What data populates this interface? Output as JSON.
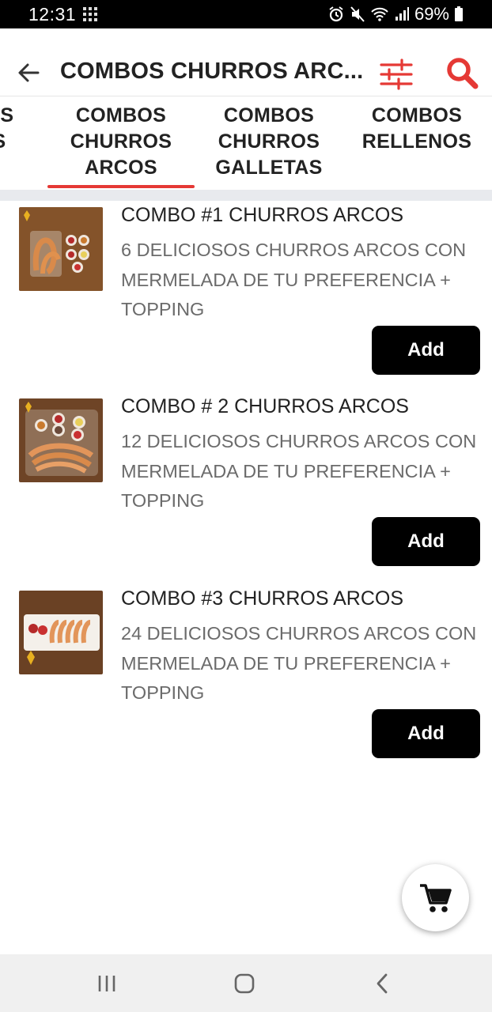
{
  "status_bar": {
    "time": "12:31",
    "battery": "69%"
  },
  "header": {
    "title": "COMBOS CHURROS ARC...",
    "back_icon": "arrow-left-icon",
    "filter_icon": "sliders-icon",
    "search_icon": "search-icon",
    "accent_color": "#e53935"
  },
  "tabs": [
    {
      "label": "OS\nS"
    },
    {
      "label": "COMBOS\nCHURROS\nARCOS",
      "active": true
    },
    {
      "label": "COMBOS\nCHURROS\nGALLETAS"
    },
    {
      "label": "COMBOS\nRELLENOS"
    }
  ],
  "products": [
    {
      "title": "COMBO #1 CHURROS ARCOS",
      "description": "6 DELICIOSOS CHURROS ARCOS CON MERMELADA DE TU PREFERENCIA + TOPPING",
      "add_label": "Add"
    },
    {
      "title": "COMBO # 2 CHURROS ARCOS",
      "description": "12 DELICIOSOS CHURROS ARCOS CON MERMELADA DE TU PREFERENCIA + TOPPING",
      "add_label": "Add"
    },
    {
      "title": "COMBO #3 CHURROS ARCOS",
      "description": "24 DELICIOSOS CHURROS ARCOS CON MERMELADA DE TU PREFERENCIA + TOPPING",
      "add_label": "Add"
    }
  ],
  "cart": {
    "icon": "shopping-cart-icon"
  },
  "nav_bar": {
    "recents_icon": "recents-icon",
    "home_icon": "home-icon",
    "back_icon": "back-chevron-icon"
  }
}
